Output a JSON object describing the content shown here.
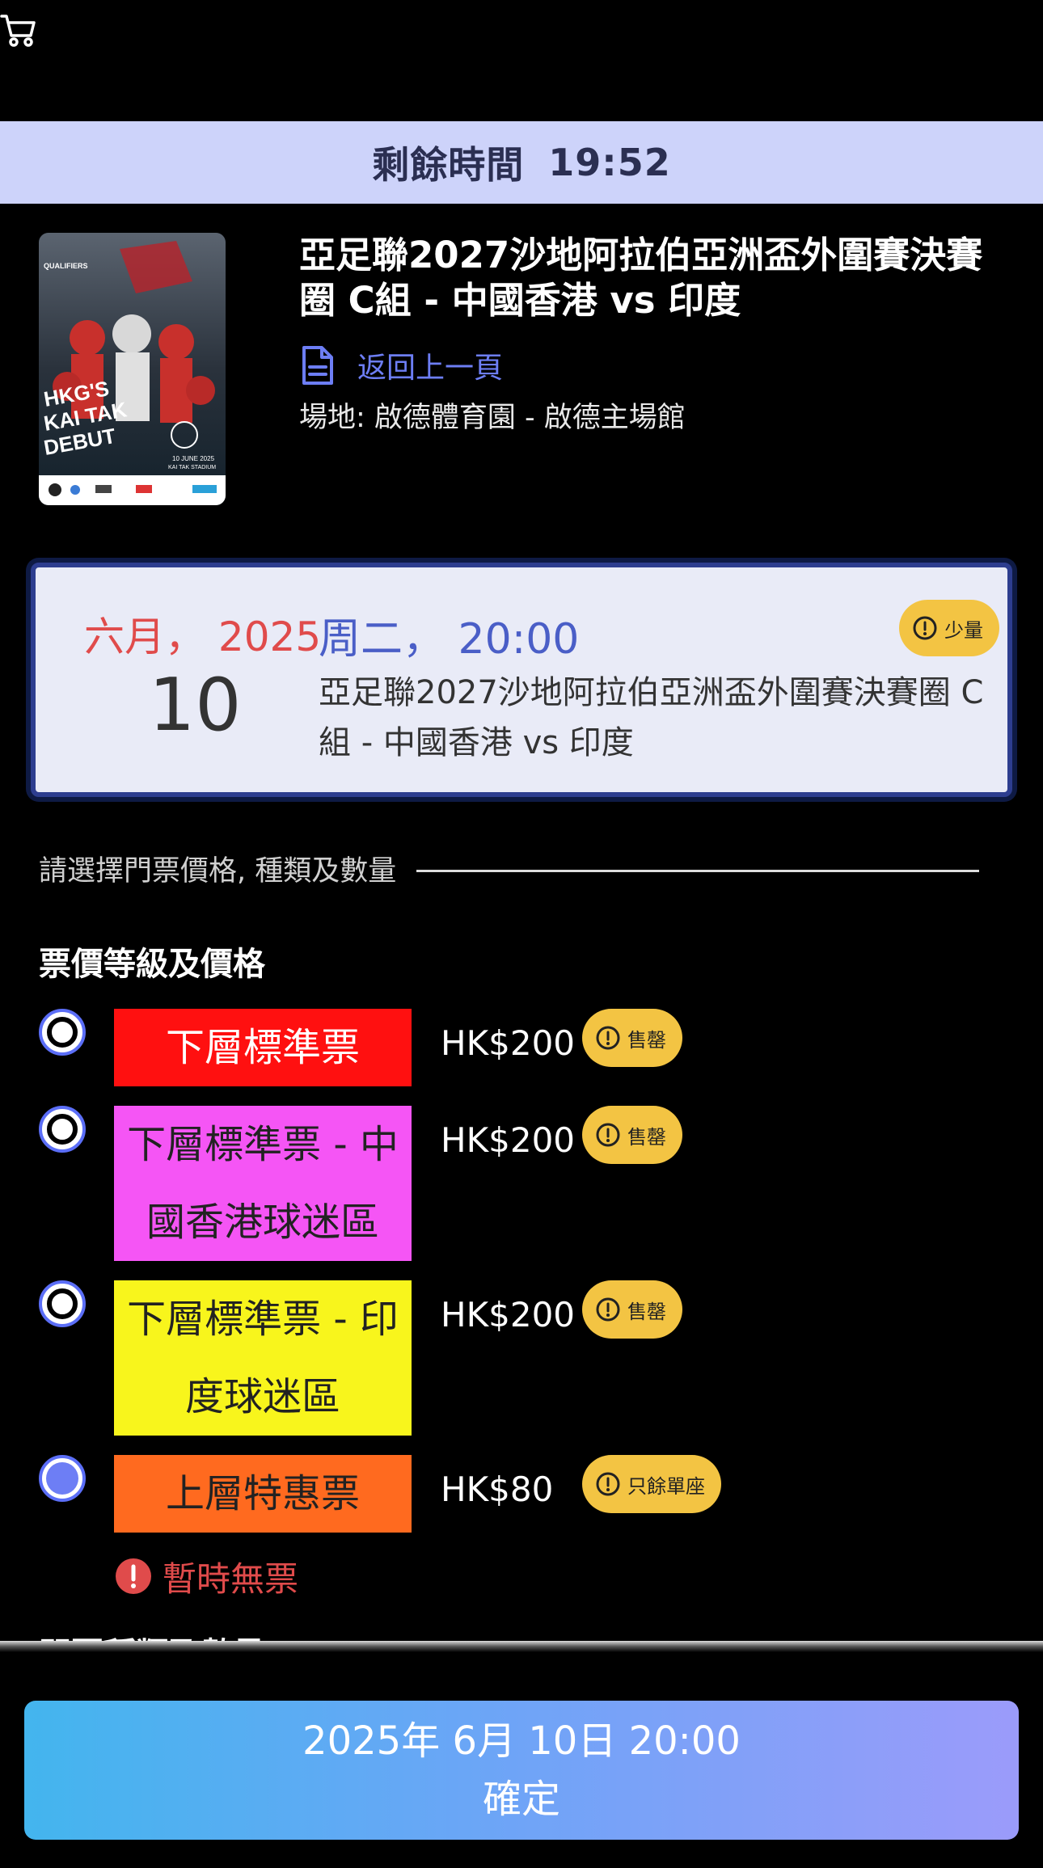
{
  "timer": {
    "label": "剩餘時間",
    "value": "19:52"
  },
  "event": {
    "title": "亞足聯2027沙地阿拉伯亞洲盃外圍賽決賽圈 C組 - 中國香港 vs 印度",
    "back_label": "返回上一頁",
    "venue": "場地: 啟德體育園 - 啟德主場館",
    "poster": {
      "top_label": "QUALIFIERS",
      "headline_lines": [
        "HKG'S",
        "KAI TAK",
        "DEBUT"
      ],
      "date_line": "10 JUNE 2025",
      "venue_line": "KAI TAK STADIUM"
    }
  },
  "date_card": {
    "month_year": "六月， 2025",
    "weekday_time": "周二， 20:00",
    "day": "10",
    "description": "亞足聯2027沙地阿拉伯亞洲盃外圍賽決賽圈 C組 - 中國香港 vs 印度",
    "badge": "少量"
  },
  "selection": {
    "hint": "請選擇門票價格, 種類及數量",
    "section_title": "票價等級及價格"
  },
  "tiers": [
    {
      "name": "下層標準票",
      "price": "HK$200",
      "status": "售罄",
      "color": "#ff1010",
      "text_color": "#ffffff",
      "selected": false
    },
    {
      "name": "下層標準票 - 中國香港球迷區",
      "price": "HK$200",
      "status": "售罄",
      "color": "#f555f5",
      "text_color": "#222222",
      "selected": false
    },
    {
      "name": "下層標準票 - 印度球迷區",
      "price": "HK$200",
      "status": "售罄",
      "color": "#f8f51c",
      "text_color": "#222222",
      "selected": false
    },
    {
      "name": "上層特惠票",
      "price": "HK$80",
      "status": "只餘單座",
      "color": "#ff6a1f",
      "text_color": "#222222",
      "selected": true
    }
  ],
  "no_ticket": "暫時無票",
  "next_section_title": "門票種類及數量",
  "confirm": {
    "datetime": "2025年 6月 10日 20:00",
    "label": "確定"
  },
  "colors": {
    "accent": "#6d7ef5",
    "badge": "#f3c443",
    "timer_bg": "#cdd3fa",
    "error": "#e04b4b"
  }
}
